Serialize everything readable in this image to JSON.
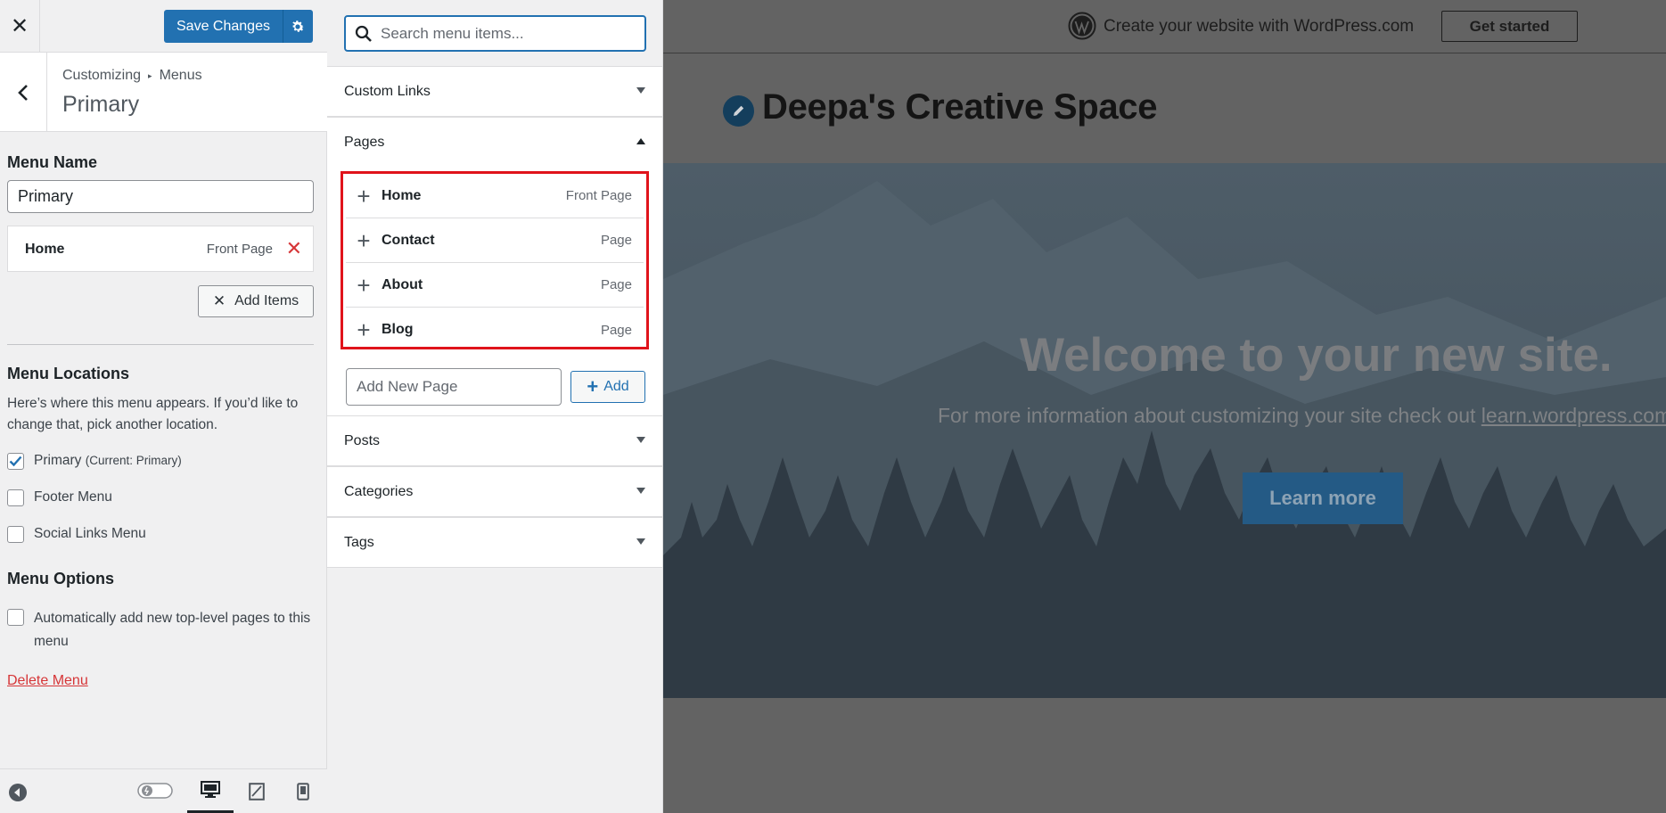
{
  "topbar": {
    "save_label": "Save Changes"
  },
  "breadcrumb": {
    "parent": "Customizing",
    "current": "Menus"
  },
  "panel": {
    "title": "Primary"
  },
  "menu_name": {
    "heading": "Menu Name",
    "value": "Primary"
  },
  "menu_items": [
    {
      "title": "Home",
      "type": "Front Page"
    }
  ],
  "add_items_label": "Add Items",
  "locations": {
    "heading": "Menu Locations",
    "description": "Here’s where this menu appears. If you’d like to change that, pick another location.",
    "options": [
      {
        "label": "Primary",
        "note": "(Current: Primary)",
        "checked": true
      },
      {
        "label": "Footer Menu",
        "checked": false
      },
      {
        "label": "Social Links Menu",
        "checked": false
      }
    ]
  },
  "options": {
    "heading": "Menu Options",
    "auto_add_label": "Automatically add new top-level pages to this menu",
    "auto_add_checked": false
  },
  "delete_label": "Delete Menu",
  "available": {
    "search_placeholder": "Search menu items...",
    "sections": {
      "custom_links": "Custom Links",
      "pages": "Pages",
      "posts": "Posts",
      "categories": "Categories",
      "tags": "Tags"
    },
    "pages": [
      {
        "name": "Home",
        "type": "Front Page"
      },
      {
        "name": "Contact",
        "type": "Page"
      },
      {
        "name": "About",
        "type": "Page"
      },
      {
        "name": "Blog",
        "type": "Page"
      }
    ],
    "new_page_placeholder": "Add New Page",
    "add_label": "Add"
  },
  "preview": {
    "banner_text": "Create your website with WordPress.com",
    "get_started": "Get started",
    "site_title": "Deepa's Creative Space",
    "hero_title": "Welcome to your new site.",
    "hero_sub": "For more information about customizing your site check out ",
    "hero_link": "learn.wordpress.com",
    "learn_more": "Learn more"
  },
  "colors": {
    "accent": "#2271b1",
    "danger": "#d63638",
    "highlight_border": "#e0131b"
  }
}
